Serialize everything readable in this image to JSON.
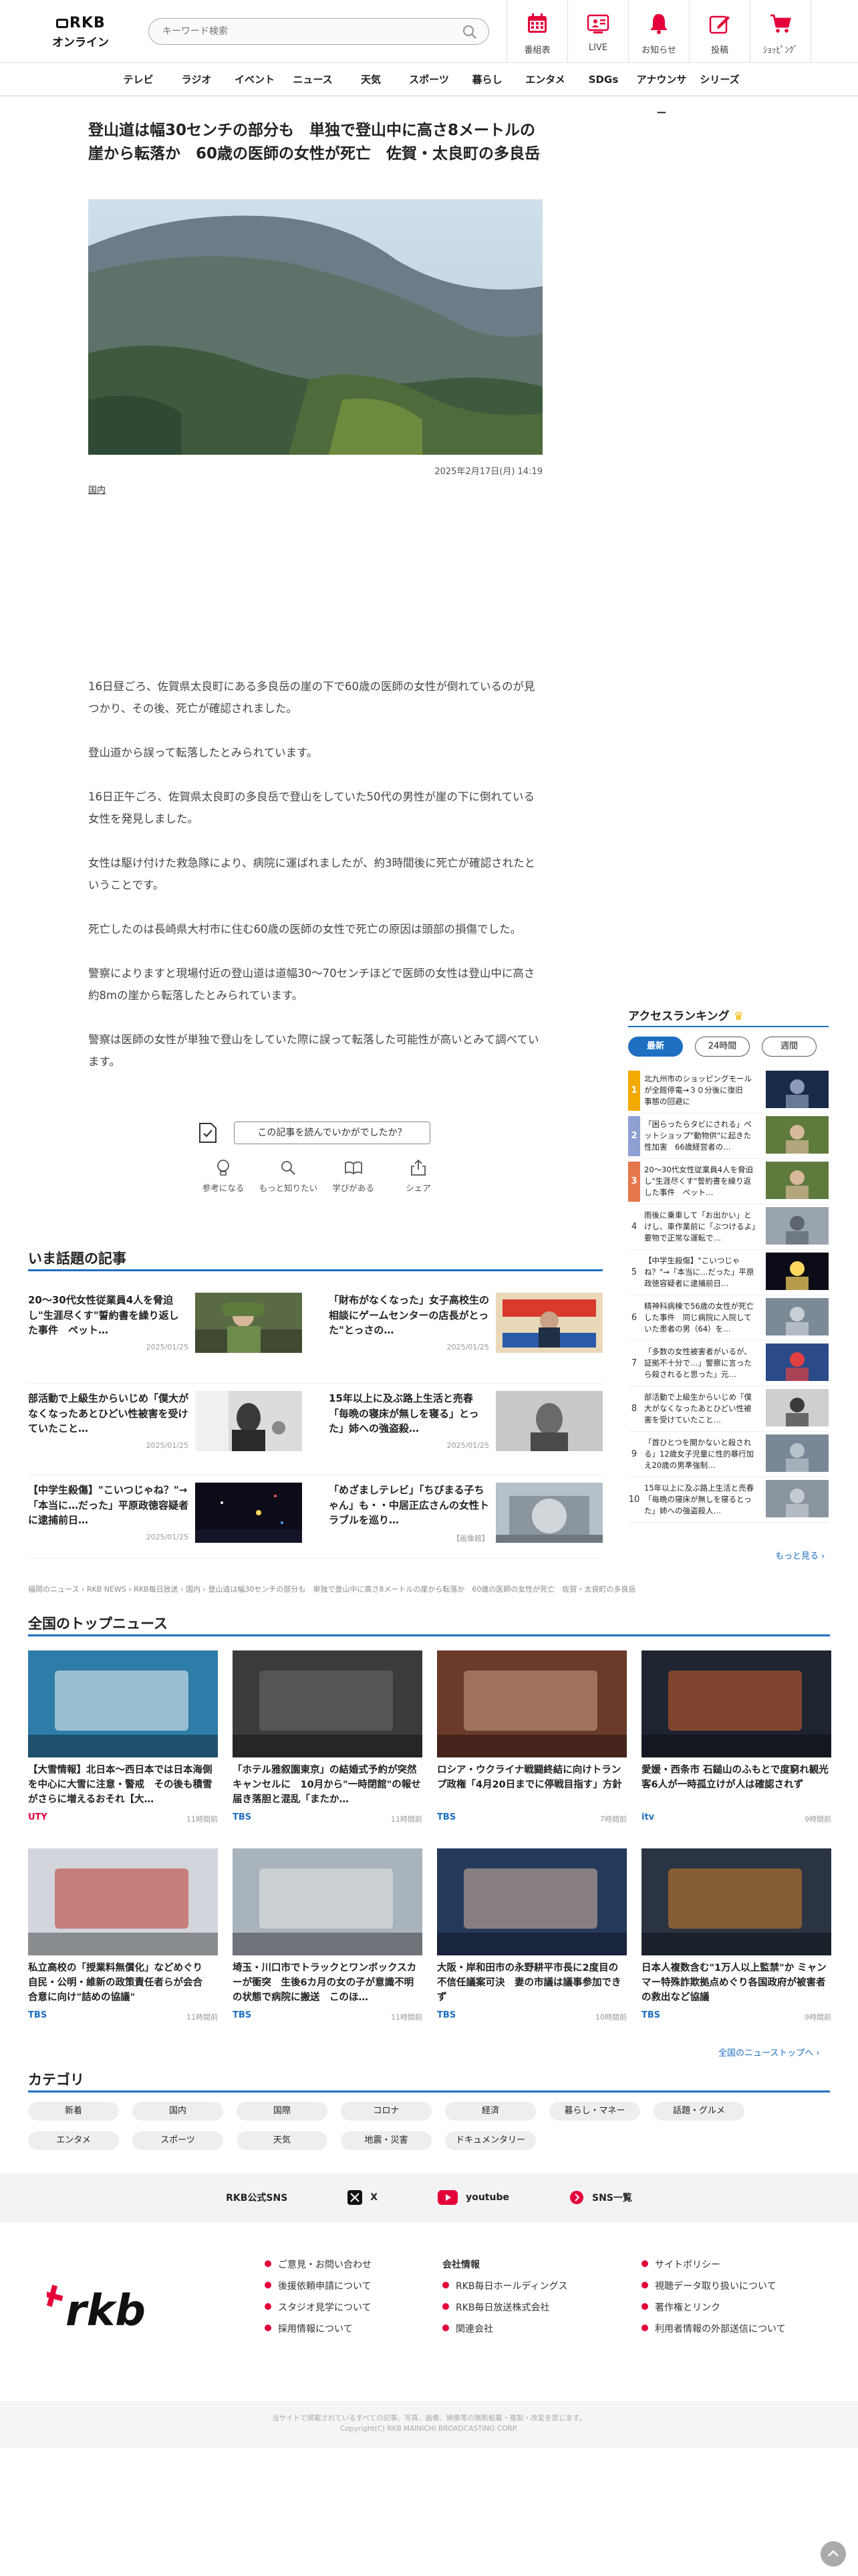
{
  "header": {
    "logo_top": "RKB",
    "logo_bottom": "オンライン",
    "search_placeholder": "キーワード検索",
    "icons": [
      {
        "label": "番組表",
        "icon": "calendar-icon"
      },
      {
        "label": "LIVE",
        "icon": "live-tv-icon"
      },
      {
        "label": "お知らせ",
        "icon": "bell-icon"
      },
      {
        "label": "投稿",
        "icon": "post-edit-icon"
      },
      {
        "label": "ｼｮｯﾋﾟﾝｸﾞ",
        "icon": "cart-icon"
      }
    ],
    "accent": "#e4003a"
  },
  "nav": [
    "テレビ",
    "ラジオ",
    "イベント",
    "ニュース",
    "天気",
    "スポーツ",
    "暮らし",
    "エンタメ",
    "SDGs",
    "アナウンサー",
    "シリーズ"
  ],
  "article": {
    "title": "登山道は幅30センチの部分も　単独で登山中に高さ8メートルの崖から転落か　60歳の医師の女性が死亡　佐賀・太良町の多良岳",
    "date": "2025年2月17日(月) 14:19",
    "category": "国内",
    "paragraphs": [
      "16日昼ごろ、佐賀県太良町にある多良岳の崖の下で60歳の医師の女性が倒れているのが見つかり、その後、死亡が確認されました。",
      "登山道から誤って転落したとみられています。",
      "16日正午ごろ、佐賀県太良町の多良岳で登山をしていた50代の男性が崖の下に倒れている女性を発見しました。",
      "女性は駆け付けた救急隊により、病院に運ばれましたが、約3時間後に死亡が確認されたということです。",
      "死亡したのは長崎県大村市に住む60歳の医師の女性で死亡の原因は頭部の損傷でした。",
      "警察によりますと現場付近の登山道は道幅30～70センチほどで医師の女性は登山中に高さ約8mの崖から転落したとみられています。",
      "警察は医師の女性が単独で登山をしていた際に誤って転落した可能性が高いとみて調べています。"
    ],
    "feedback_question": "この記事を読んでいかがでしたか？",
    "reactions": [
      "参考になる",
      "もっと知りたい",
      "学びがある",
      "シェア"
    ]
  },
  "hot_topics": {
    "heading": "いま話題の記事",
    "items": [
      {
        "title": "20～30代女性従業員4人を脅迫し\"生涯尽くす\"誓約書を繰り返した事件　ペット…",
        "date": "2025/01/25"
      },
      {
        "title": "「財布がなくなった」女子高校生の相談にゲームセンターの店長がとった\"とっさの…",
        "date": "2025/01/25"
      },
      {
        "title": "部活動で上級生からいじめ「僕大がなくなったあとひどい性被害を受けていたこと…",
        "date": "2025/01/25"
      },
      {
        "title": "15年以上に及ぶ路上生活と売春「毎晩の寝床が無しを寝る」とった」姉への強盗殺…",
        "date": "2025/01/25"
      },
      {
        "title": "【中学生殺傷】\"こいつじゃね？\"→「本当に…だった」平原政徳容疑者に逮捕前日…",
        "date": "2025/01/25"
      },
      {
        "title": "「めざましテレビ」「ちびまる子ちゃん」も・・中居正広さんの女性トラブルを巡り…",
        "date": "【画像館】"
      }
    ]
  },
  "ranking": {
    "heading": "アクセスランキング",
    "tabs": [
      "最新",
      "24時間",
      "週間"
    ],
    "more": "もっと見る ›",
    "items": [
      {
        "rank": "1",
        "title": "北九州市のショッピングモールが全館停電→３０分後に復旧　事態の回避に",
        "color": "#f2a900"
      },
      {
        "rank": "2",
        "title": "「困らったらタビにされる」ペットショップ\"動物供\"に起きた性加害　66歳経営者の…",
        "color": "#8e9fd2"
      },
      {
        "rank": "3",
        "title": "20～30代女性従業員4人を脅迫し\"生涯尽くす\"誓約書を繰り返した事件　ペット…",
        "color": "#e5774a"
      },
      {
        "rank": "4",
        "title": "雨後に乗車して「お出かい」とけし、車作業前に「ぶつけるよ」要物で正常な運転で…",
        "color": ""
      },
      {
        "rank": "5",
        "title": "【中学生殺傷】\"こいつじゃね？\"→「本当に…だった」平原政徳容疑者に逮捕前日…",
        "color": ""
      },
      {
        "rank": "6",
        "title": "精神科病棟で56歳の女性が死亡した事件　同じ病院に入院していた患者の男（64）を…",
        "color": ""
      },
      {
        "rank": "7",
        "title": "「多数の女性被害者がいるが、証拠不十分で…」警察に言ったら殺されると思った」元…",
        "color": ""
      },
      {
        "rank": "8",
        "title": "部活動で上級生からいじめ「僕大がなくなったあとひどい性被害を受けていたこと…",
        "color": ""
      },
      {
        "rank": "9",
        "title": "「首ひとつを開かないと殺される」12歳女子児童に性的暴行加え20歳の男準強制…",
        "color": ""
      },
      {
        "rank": "10",
        "title": "15年以上に及ぶ路上生活と売春「毎晩の寝床が無しを寝るとった」姉への強盗殺人…",
        "color": ""
      }
    ]
  },
  "breadcrumb": "福岡のニュース › RKB NEWS › RKB毎日放送 › 国内 › 登山道は幅30センチの部分も　単独で登山中に高さ8メートルの崖から転落か　60歳の医師の女性が死亡　佐賀・太良町の多良岳",
  "top_news": {
    "heading": "全国のトップニュース",
    "more": "全国のニューストップへ ›",
    "items": [
      {
        "title": "【大雪情報】北日本～西日本では日本海側を中心に大雪に注意・警戒　その後も積雪がさらに増えるおそれ【大…",
        "source": "UTY",
        "source_color": "#e4003a",
        "time": "11時間前"
      },
      {
        "title": "「ホテル雅叙園東京」の結婚式予約が突然キャンセルに　10月から\"一時閉館\"の報せ届き落胆と混乱「またか…",
        "source": "TBS",
        "source_color": "#1e6fc2",
        "time": "11時間前"
      },
      {
        "title": "ロシア・ウクライナ戦闘終結に向けトランプ政権「4月20日までに停戦目指す」方針",
        "source": "TBS",
        "source_color": "#1e6fc2",
        "time": "7時間前"
      },
      {
        "title": "愛媛・西条市 石鎚山のふもとで度窮れ観光客6人が一時孤立けが人は確認されず",
        "source": "itv",
        "source_color": "#1e6fc2",
        "time": "9時間前"
      },
      {
        "title": "私立高校の「授業料無償化」などめぐり　自民・公明・維新の政策責任者らが会合　合意に向け\"詰めの協議\"",
        "source": "TBS",
        "source_color": "#1e6fc2",
        "time": "11時間前"
      },
      {
        "title": "埼玉・川口市でトラックとワンボックスカーが衝突　生後6カ月の女の子が意識不明の状態で病院に搬送　このほ…",
        "source": "TBS",
        "source_color": "#1e6fc2",
        "time": "11時間前"
      },
      {
        "title": "大阪・岸和田市の永野耕平市長に2度目の不信任議案可決　妻の市議は議事参加できず",
        "source": "TBS",
        "source_color": "#1e6fc2",
        "time": "10時間前"
      },
      {
        "title": "日本人複数含む\"1万人以上監禁\"か ミャンマー特殊詐欺拠点めぐり各国政府が被害者の救出など協議",
        "source": "TBS",
        "source_color": "#1e6fc2",
        "time": "9時間前"
      }
    ]
  },
  "categories": {
    "heading": "カテゴリ",
    "items": [
      "新着",
      "国内",
      "国際",
      "コロナ",
      "経済",
      "暮らし・マネー",
      "話題・グルメ",
      "エンタメ",
      "スポーツ",
      "天気",
      "地震・災害",
      "ドキュメンタリー"
    ]
  },
  "sns": {
    "label": "RKB公式SNS",
    "items": [
      {
        "label": "X",
        "icon": "x-icon"
      },
      {
        "label": "youtube",
        "icon": "youtube-icon"
      },
      {
        "label": "SNS一覧",
        "icon": "sns-list-icon"
      }
    ]
  },
  "footer": {
    "logo": "rkb",
    "col1": [
      "ご意見・お問い合わせ",
      "後援依頼申請について",
      "スタジオ見学について",
      "採用情報について"
    ],
    "col2_heading": "会社情報",
    "col2": [
      "RKB毎日ホールディングス",
      "RKB毎日放送株式会社",
      "関連会社"
    ],
    "col3": [
      "サイトポリシー",
      "視聴データ取り扱いについて",
      "著作権とリンク",
      "利用者情報の外部送信について"
    ],
    "copyright_1": "当サイトで掲載されているすべての記事、写真、画像、映像等の無断転載・複製・改変を禁じます。",
    "copyright_2": "Copyright(C) RKB MAINICHI BROADCASTING CORP."
  }
}
